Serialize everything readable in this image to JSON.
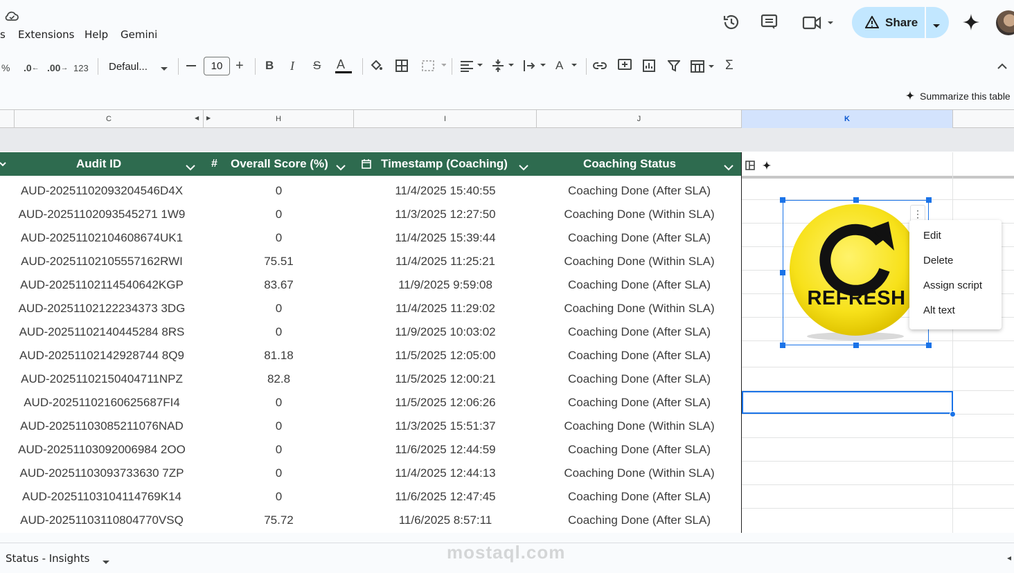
{
  "menu": {
    "partial": "s",
    "extensions": "Extensions",
    "help": "Help",
    "gemini": "Gemini"
  },
  "header_actions": {
    "share_label": "Share"
  },
  "toolbar": {
    "percent": "%",
    "dec_decrease": ".0",
    "dec_increase": ".00",
    "number_format": "123",
    "font_family": "Defaul...",
    "font_size": "10",
    "summarize": "Summarize this table"
  },
  "columns": [
    "C",
    "H",
    "I",
    "J",
    "K"
  ],
  "table": {
    "headers": [
      "Audit ID",
      "Overall Score (%)",
      "Timestamp (Coaching)",
      "Coaching Status"
    ],
    "rows": [
      [
        "AUD-20251102093204546D4X",
        "0",
        "11/4/2025 15:40:55",
        "Coaching Done (After SLA)"
      ],
      [
        "AUD-20251102093545271 1W9",
        "0",
        "11/3/2025 12:27:50",
        "Coaching Done (Within SLA)"
      ],
      [
        "AUD-20251102104608674UK1",
        "0",
        "11/4/2025 15:39:44",
        "Coaching Done (After SLA)"
      ],
      [
        "AUD-20251102105557162RWI",
        "75.51",
        "11/4/2025 11:25:21",
        "Coaching Done (Within SLA)"
      ],
      [
        "AUD-20251102114540642KGP",
        "83.67",
        "11/9/2025 9:59:08",
        "Coaching Done (After SLA)"
      ],
      [
        "AUD-20251102122234373 3DG",
        "0",
        "11/4/2025 11:29:02",
        "Coaching Done (Within SLA)"
      ],
      [
        "AUD-20251102140445284 8RS",
        "0",
        "11/9/2025 10:03:02",
        "Coaching Done (After SLA)"
      ],
      [
        "AUD-20251102142928744 8Q9",
        "81.18",
        "11/5/2025 12:05:00",
        "Coaching Done (After SLA)"
      ],
      [
        "AUD-20251102150404711NPZ",
        "82.8",
        "11/5/2025 12:00:21",
        "Coaching Done (After SLA)"
      ],
      [
        "AUD-20251102160625687FI4",
        "0",
        "11/5/2025 12:06:26",
        "Coaching Done (After SLA)"
      ],
      [
        "AUD-20251103085211076NAD",
        "0",
        "11/3/2025 15:51:37",
        "Coaching Done (Within SLA)"
      ],
      [
        "AUD-20251103092006984 2OO",
        "0",
        "11/6/2025 12:44:59",
        "Coaching Done (After SLA)"
      ],
      [
        "AUD-20251103093733630 7ZP",
        "0",
        "11/4/2025 12:44:13",
        "Coaching Done (Within SLA)"
      ],
      [
        "AUD-20251103104114769K14",
        "0",
        "11/6/2025 12:47:45",
        "Coaching Done (After SLA)"
      ],
      [
        "AUD-20251103110804770VSQ",
        "75.72",
        "11/6/2025 8:57:11",
        "Coaching Done (After SLA)"
      ]
    ]
  },
  "image": {
    "label": "REFRESH"
  },
  "context_menu": [
    "Edit",
    "Delete",
    "Assign script",
    "Alt text"
  ],
  "sheet_tab": {
    "label": "Status - Insights"
  },
  "watermark": "mostaql.com",
  "colors": {
    "header_green": "#2e6b4f",
    "accent_blue": "#1a73e8",
    "share_bg": "#c2e7ff",
    "refresh_yellow": "#f7e11a"
  }
}
